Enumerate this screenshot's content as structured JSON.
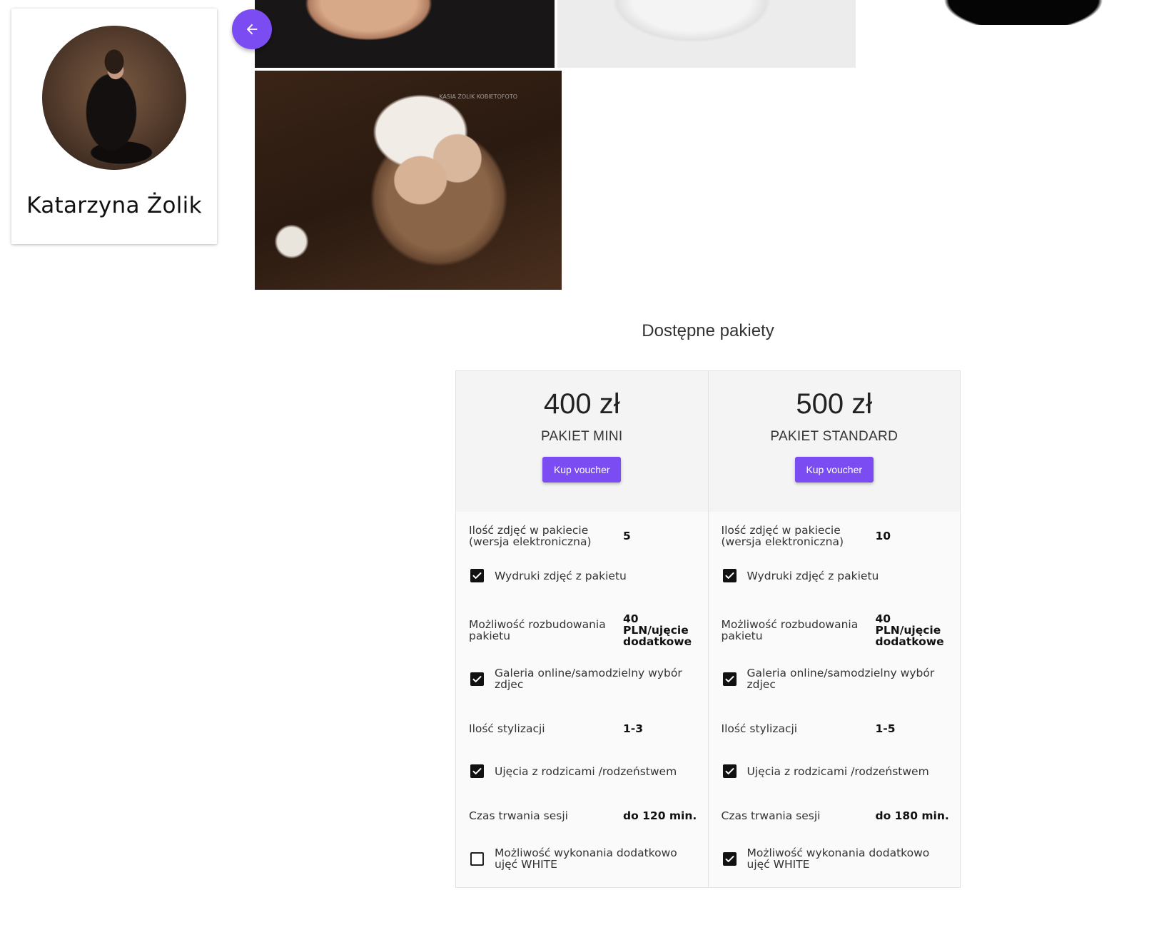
{
  "profile": {
    "name": "Katarzyna Żolik"
  },
  "gallery": {
    "watermark": "KASIA ŻOLIK KOBIETOFOTO"
  },
  "packages_section": {
    "title": "Dostępne pakiety",
    "buy_label": "Kup voucher",
    "feature_labels": {
      "photos": "Ilość zdjęć w pakiecie (wersja elektroniczna)",
      "prints": "Wydruki zdjęć z pakietu",
      "expand": "Możliwość rozbudowania pakietu",
      "gallery": "Galeria online/samodzielny wybór zdjec",
      "styles": "Ilość stylizacji",
      "parents": "Ujęcia z rodzicami /rodzeństwem",
      "duration": "Czas trwania sesji",
      "white": "Możliwość wykonania dodatkowo ujęć WHITE"
    },
    "packages": [
      {
        "price": "400 zł",
        "name": "PAKIET MINI",
        "photos": "5",
        "prints": true,
        "expand": "40 PLN/ujęcie dodatkowe",
        "gallery": true,
        "styles": "1-3",
        "parents": true,
        "duration": "do 120 min.",
        "white": false
      },
      {
        "price": "500 zł",
        "name": "PAKIET STANDARD",
        "photos": "10",
        "prints": true,
        "expand": "40 PLN/ujęcie dodatkowe",
        "gallery": true,
        "styles": "1-5",
        "parents": true,
        "duration": "do 180 min.",
        "white": true
      }
    ]
  },
  "colors": {
    "accent": "#7a4cf2",
    "header_bg": "#f4f4f4",
    "feature_bg": "#fafafa"
  },
  "icons": {
    "back": "arrow-left-icon",
    "checked": "checkbox-checked-icon",
    "unchecked": "checkbox-unchecked-icon"
  }
}
